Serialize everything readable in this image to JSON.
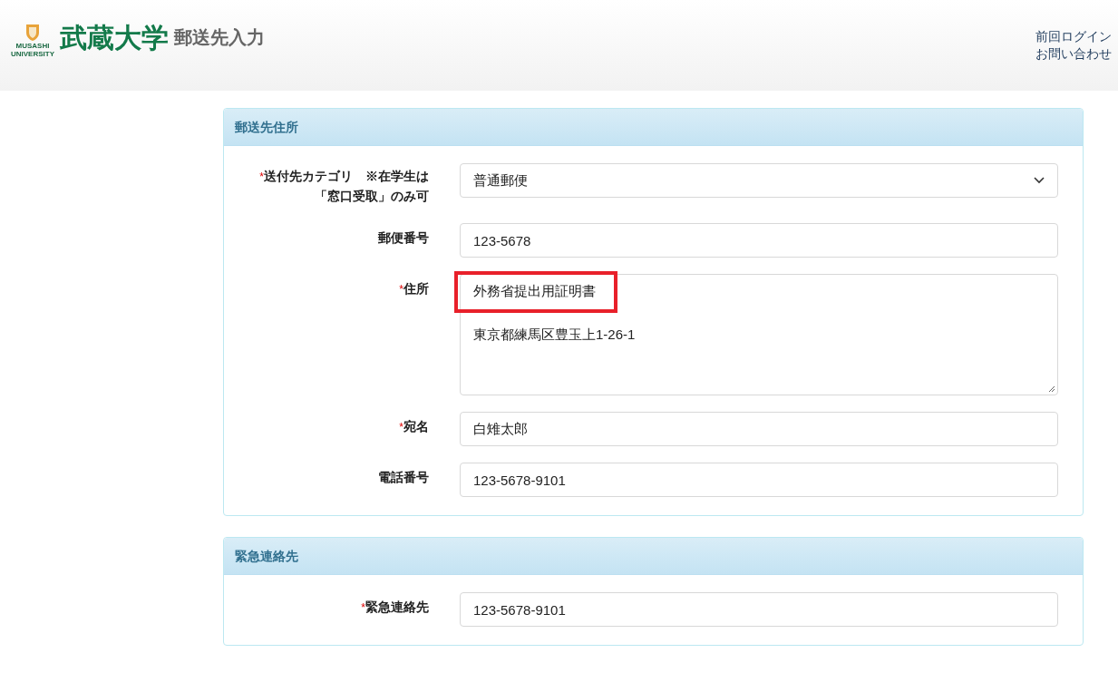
{
  "header": {
    "logo_caption": "MUSASHI UNIVERSITY",
    "logo_text": "武蔵大学",
    "page_title": "郵送先入力",
    "links": [
      "前回ログイン",
      "お問い合わせ"
    ]
  },
  "panels": [
    {
      "title": "郵送先住所",
      "fields": [
        {
          "kind": "select",
          "marker": "*",
          "label": "送付先カテゴリ　※在学生は「窓口受取」のみ可",
          "value": "普通郵便"
        },
        {
          "kind": "input",
          "label": "郵便番号",
          "value": "123-5678"
        },
        {
          "kind": "textarea",
          "marker": "*",
          "label": "住所",
          "lines": [
            {
              "text": "外務省提出用証明書",
              "highlighted": true
            },
            {
              "text": "東京都練馬区豊玉上1-26-1",
              "highlighted": false
            }
          ]
        },
        {
          "kind": "input",
          "marker": "*",
          "label": "宛名",
          "value": "白雉太郎"
        },
        {
          "kind": "input",
          "label": "電話番号",
          "value": "123-5678-9101"
        }
      ]
    },
    {
      "title": "緊急連絡先",
      "fields": [
        {
          "kind": "input",
          "marker": "*",
          "label": "緊急連絡先",
          "value": "123-5678-9101"
        }
      ]
    }
  ]
}
